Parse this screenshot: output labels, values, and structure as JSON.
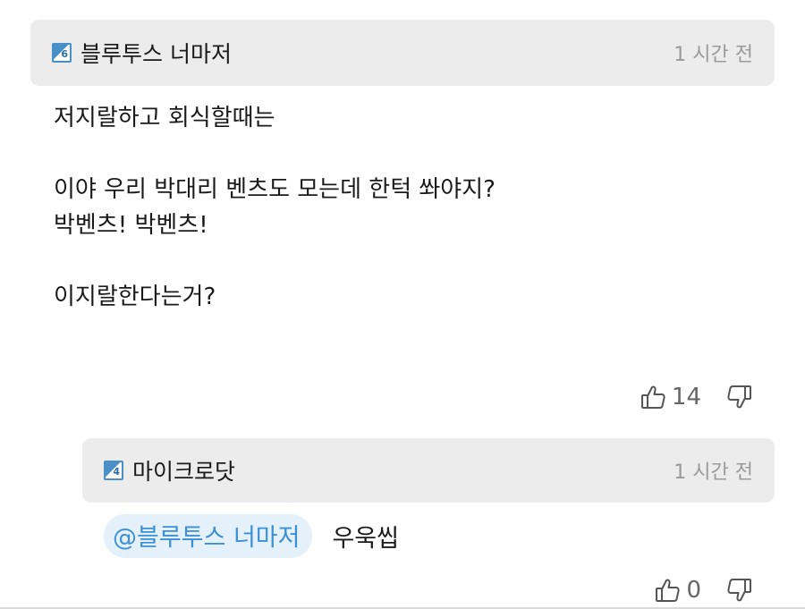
{
  "comment": {
    "level": "6",
    "author": "블루투스 너마저",
    "time": "1 시간 전",
    "lines": [
      "저지랄하고 회식할때는",
      "",
      "이야 우리 박대리 벤츠도 모는데 한턱 쏴야지?",
      "박벤츠! 박벤츠!",
      "",
      "이지랄한다는거?"
    ],
    "likes": "14",
    "icons": {
      "like": "thumbs-up-icon",
      "dislike": "thumbs-down-icon",
      "badge": "level-badge-icon"
    }
  },
  "reply": {
    "level": "4",
    "author": "마이크로닷",
    "time": "1 시간 전",
    "mention": "@블루투스 너마저",
    "text": "우욱씹",
    "likes": "0"
  },
  "colors": {
    "header_bg": "#ececec",
    "mention_bg": "#e4f1fb",
    "mention_text": "#3d8fd6",
    "badge": "#4a90c8",
    "muted": "#9a9a9a"
  }
}
